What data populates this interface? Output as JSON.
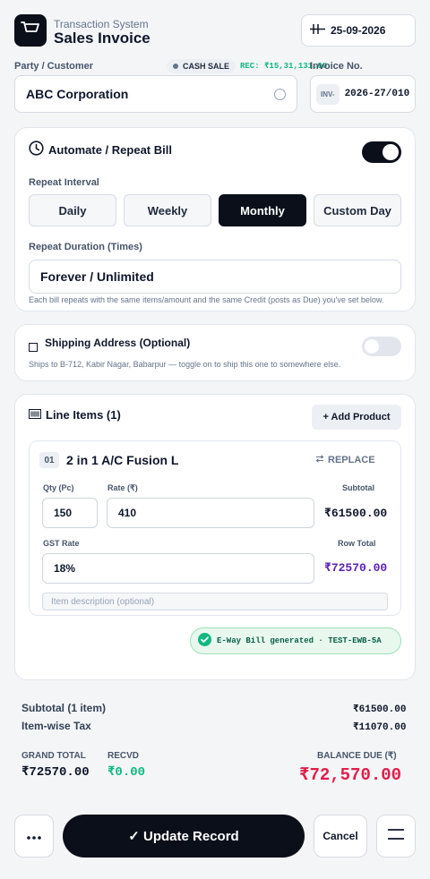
{
  "header": {
    "subtitle": "Transaction System",
    "title": "Sales Invoice",
    "date": "25-09-2026"
  },
  "party": {
    "label": "Party / Customer",
    "value": "ABC Corporation",
    "cash_sale_label": "CASH SALE",
    "rec_text": "REC: ₹15,31,131.00"
  },
  "invoice": {
    "label": "Invoice No.",
    "prefix": "INV-",
    "number": "2026-27/010"
  },
  "repeat": {
    "title": "Automate / Repeat Bill",
    "enabled": true,
    "interval_label": "Repeat Interval",
    "intervals": [
      "Daily",
      "Weekly",
      "Monthly",
      "Custom Day"
    ],
    "selected_interval": "Monthly",
    "duration_label": "Repeat Duration (Times)",
    "duration_value": "Forever / Unlimited",
    "help": "Each bill repeats with the same items/amount and the same Credit (posts as Due) you've set below."
  },
  "shipping": {
    "title": "Shipping Address (Optional)",
    "subtitle": "Ships to B-712, Kabir Nagar, Babarpur — toggle on to ship this one to somewhere else.",
    "enabled": false
  },
  "line_items": {
    "title": "Line Items (1)",
    "add_label": "+ Add Product",
    "items": [
      {
        "index": "01",
        "name": "2 in 1 A/C Fusion L",
        "replace_label": "REPLACE",
        "qty_label": "Qty (Pc)",
        "qty": "150",
        "rate_label": "Rate (₹)",
        "rate": "410",
        "subtotal_label": "Subtotal",
        "subtotal": "₹61500.00",
        "gst_label": "GST Rate",
        "gst": "18%",
        "row_total_label": "Row Total",
        "row_total": "₹72570.00",
        "desc_placeholder": "Item description (optional)"
      }
    ],
    "eway_text": "E-Way Bill generated · TEST-EWB-5A"
  },
  "summary": {
    "subtotal_label": "Subtotal (1 item)",
    "subtotal_value": "₹61500.00",
    "tax_label": "Item-wise Tax",
    "tax_value": "₹11070.00",
    "grand_total_label": "GRAND TOTAL",
    "grand_total_value": "₹72570.00",
    "recvd_label": "RECVD",
    "recvd_value": "₹0.00",
    "balance_label": "BALANCE DUE (₹)",
    "balance_value": "₹72,570.00"
  },
  "actions": {
    "update_label": "✓ Update Record",
    "cancel_label": "Cancel"
  },
  "icons": {
    "app": "cart-icon",
    "date": "calendar-icon",
    "repeat": "clock-icon",
    "items": "barcode-icon",
    "replace": "swap-icon",
    "eway": "check-circle-icon",
    "more": "more-dots-icon",
    "menu": "menu-icon"
  },
  "colors": {
    "primary": "#0b0f19",
    "accent_green": "#10b981",
    "row_total": "#5b21b6",
    "balance_due": "#e11d48"
  }
}
